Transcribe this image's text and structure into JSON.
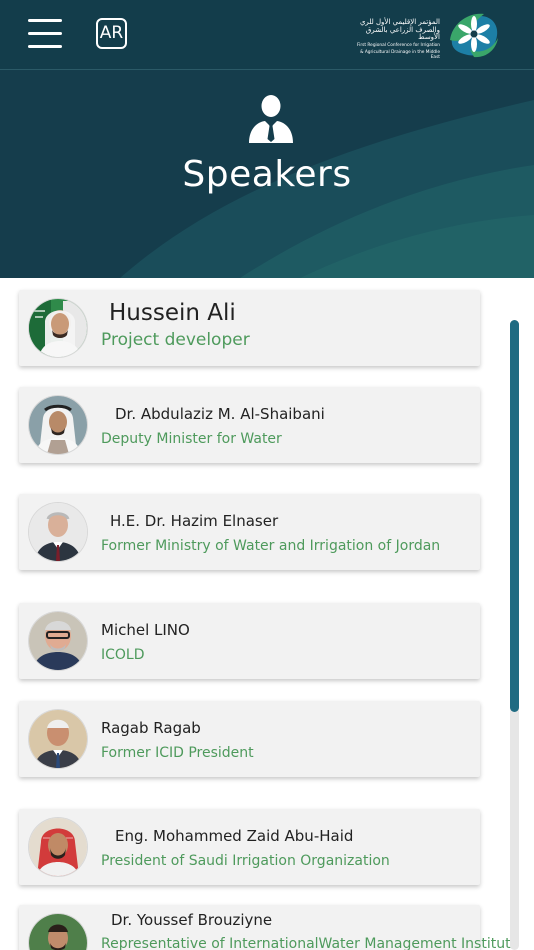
{
  "header": {
    "menu_icon": "hamburger-menu-icon",
    "language_button": "AR",
    "logo_arabic_line1": "المؤتمر الإقليمي الأول للري",
    "logo_arabic_line2": "والصرف الزراعي بالشرق الأوسط",
    "logo_english_line1": "First Regional Conference for Irrigation",
    "logo_english_line2": "& Agricultural Drainage in the Middle East",
    "colors": {
      "bar": "#133d4b",
      "logo_green": "#3aa66a",
      "logo_blue": "#1d7fa6"
    }
  },
  "hero": {
    "icon": "speaker-person-icon",
    "title": "Speakers"
  },
  "speakers": [
    {
      "name": "Hussein Ali",
      "role": "Project developer"
    },
    {
      "name": "Dr. Abdulaziz M. Al-Shaibani",
      "role": "Deputy Minister for Water"
    },
    {
      "name": "H.E. Dr. Hazim Elnaser",
      "role": "Former Ministry of Water and Irrigation of Jordan"
    },
    {
      "name": "Michel LINO",
      "role": "ICOLD"
    },
    {
      "name": "Ragab Ragab",
      "role": "Former ICID President"
    },
    {
      "name": "Eng. Mohammed Zaid Abu-Haid",
      "role": "President of Saudi Irrigation Organization"
    },
    {
      "name": "Dr. Youssef Brouziyne",
      "role": "Representative of InternationalWater Management Institute"
    }
  ],
  "theme": {
    "role_color": "#4e9a5c",
    "card_bg": "#f2f2f2",
    "scroll_color": "#1f6b82"
  }
}
